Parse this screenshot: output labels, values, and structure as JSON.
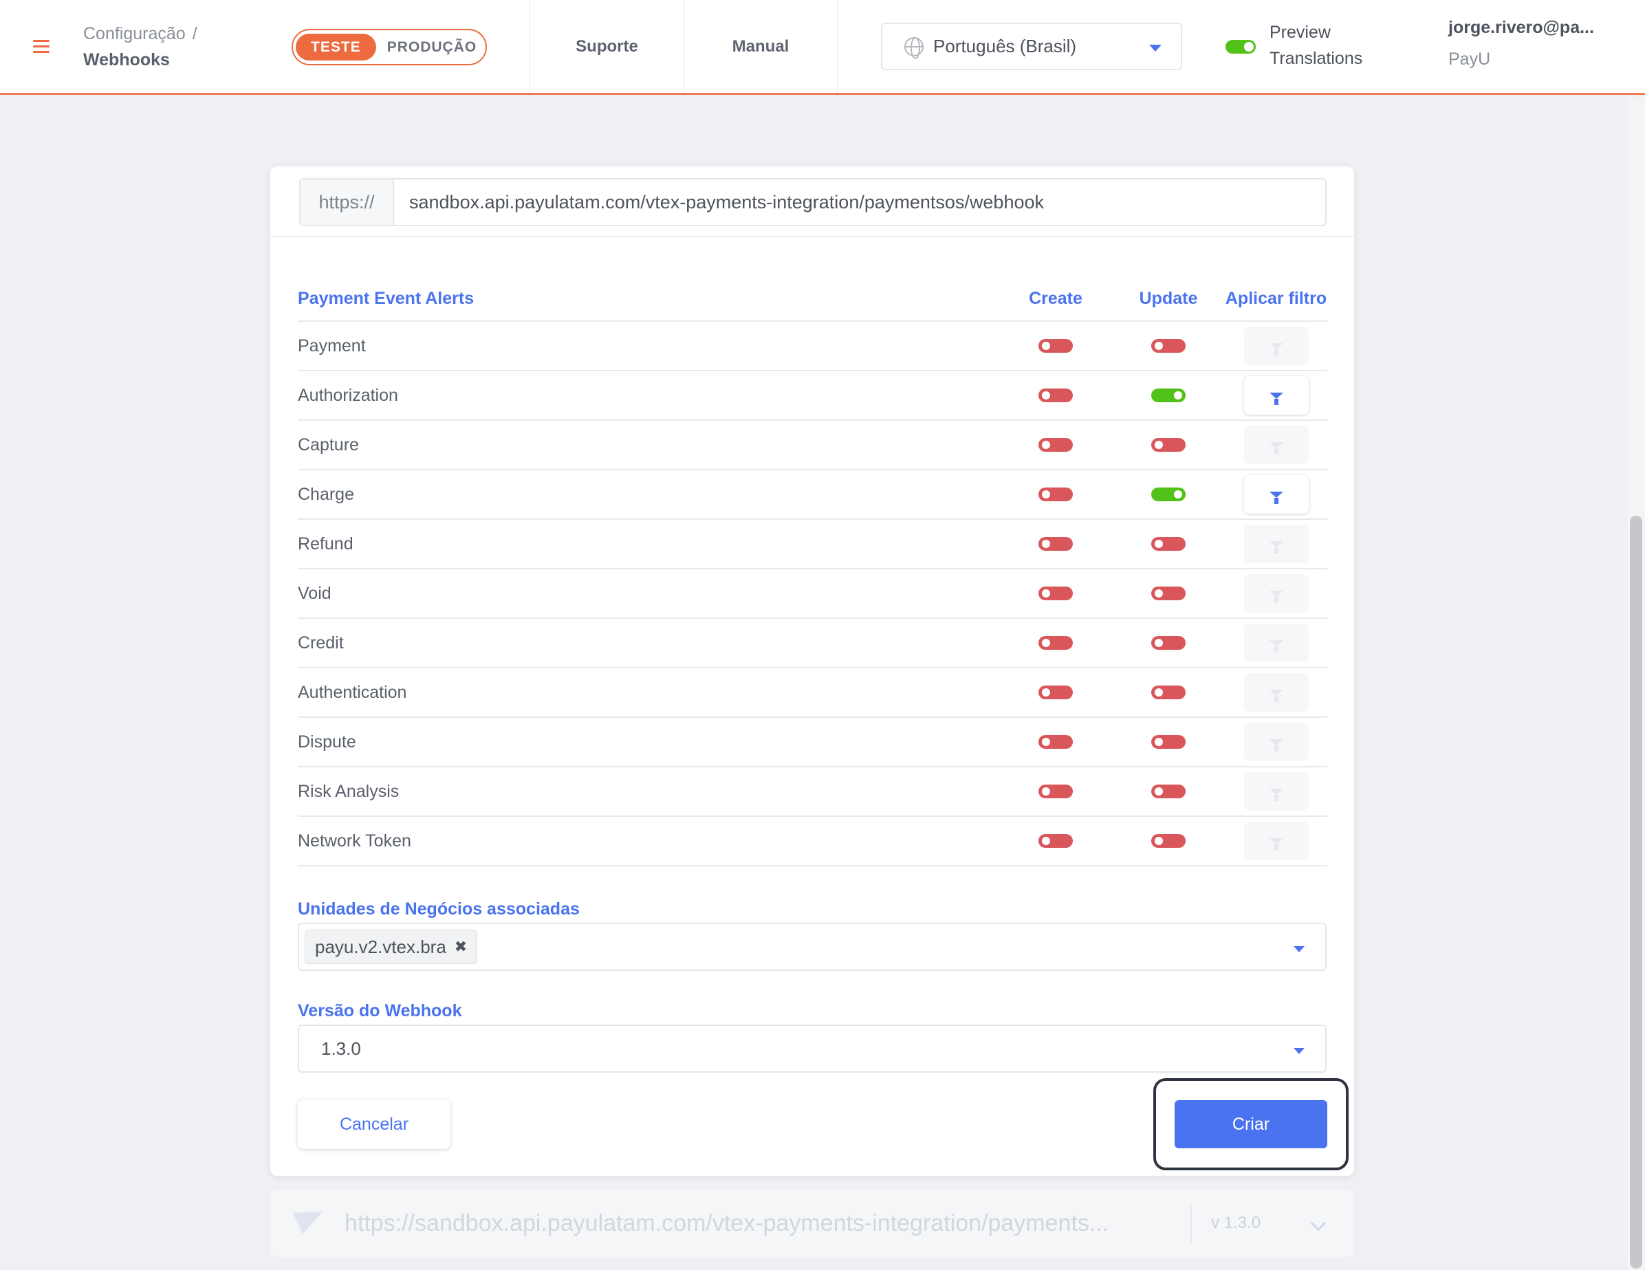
{
  "header": {
    "breadcrumb_parent": "Configuração",
    "breadcrumb_sep": "/",
    "breadcrumb_current": "Webhooks",
    "env_active": "TESTE",
    "env_inactive": "PRODUÇÃO",
    "nav_support": "Suporte",
    "nav_manual": "Manual",
    "language": "Português (Brasil)",
    "preview_line1": "Preview",
    "preview_line2": "Translations",
    "preview_enabled": true,
    "user_email": "jorge.rivero@pa...",
    "user_org": "PayU"
  },
  "webhook_form": {
    "url_prefix": "https://",
    "url_value": "sandbox.api.payulatam.com/vtex-payments-integration/paymentsos/webhook",
    "table_headers": {
      "name": "Payment Event Alerts",
      "create": "Create",
      "update": "Update",
      "filter": "Aplicar filtro"
    },
    "events": [
      {
        "name": "Payment",
        "create": false,
        "update": false,
        "filter_enabled": false
      },
      {
        "name": "Authorization",
        "create": false,
        "update": true,
        "filter_enabled": true
      },
      {
        "name": "Capture",
        "create": false,
        "update": false,
        "filter_enabled": false
      },
      {
        "name": "Charge",
        "create": false,
        "update": true,
        "filter_enabled": true
      },
      {
        "name": "Refund",
        "create": false,
        "update": false,
        "filter_enabled": false
      },
      {
        "name": "Void",
        "create": false,
        "update": false,
        "filter_enabled": false
      },
      {
        "name": "Credit",
        "create": false,
        "update": false,
        "filter_enabled": false
      },
      {
        "name": "Authentication",
        "create": false,
        "update": false,
        "filter_enabled": false
      },
      {
        "name": "Dispute",
        "create": false,
        "update": false,
        "filter_enabled": false
      },
      {
        "name": "Risk Analysis",
        "create": false,
        "update": false,
        "filter_enabled": false
      },
      {
        "name": "Network Token",
        "create": false,
        "update": false,
        "filter_enabled": false
      }
    ],
    "business_units_label": "Unidades de Negócios associadas",
    "business_units_selected": [
      "payu.v2.vtex.bra"
    ],
    "version_label": "Versão do Webhook",
    "version_value": "1.3.0",
    "cancel_label": "Cancelar",
    "create_label": "Criar"
  },
  "existing_webhook": {
    "url": "https://sandbox.api.payulatam.com/vtex-payments-integration/payments...",
    "version": "v 1.3.0"
  },
  "colors": {
    "accent_orange": "#ee6a3f",
    "primary_blue": "#4a73ef",
    "toggle_on": "#52c21a",
    "toggle_off": "#d9575a"
  }
}
